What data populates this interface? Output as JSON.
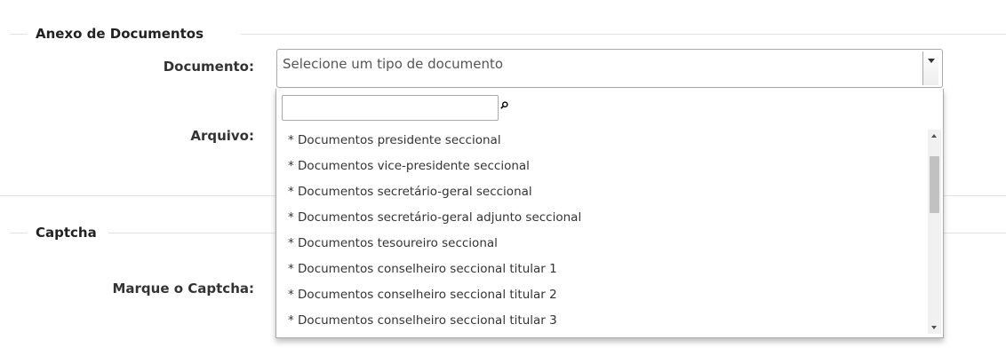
{
  "section_documents": {
    "legend": "Anexo de Documentos",
    "documento_label": "Documento:",
    "arquivo_label": "Arquivo:",
    "select": {
      "placeholder": "Selecione um tipo de documento",
      "search_value": "",
      "options": [
        "* Documentos presidente seccional",
        "* Documentos vice-presidente seccional",
        "* Documentos secretário-geral seccional",
        "* Documentos secretário-geral adjunto seccional",
        "* Documentos tesoureiro seccional",
        "* Documentos conselheiro seccional titular 1",
        "* Documentos conselheiro seccional titular 2",
        "* Documentos conselheiro seccional titular 3"
      ]
    }
  },
  "section_captcha": {
    "legend": "Captcha",
    "marque_label": "Marque o Captcha:"
  },
  "icons": {
    "select_arrow": "chevron-down-icon",
    "search": "search-icon",
    "scroll_up": "arrow-up-icon",
    "scroll_down": "arrow-down-icon"
  }
}
